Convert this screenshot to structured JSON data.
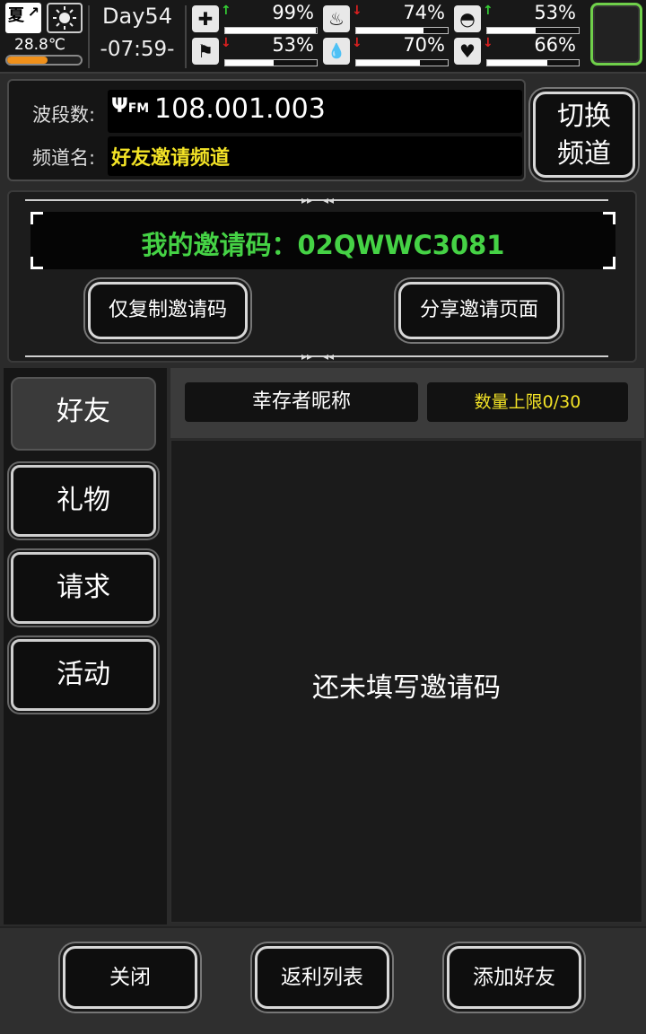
{
  "status": {
    "season": "夏",
    "temperature": "28.8℃",
    "temperature_level": 0.55,
    "day": "Day54",
    "time": "-07:59-",
    "stats": [
      {
        "name": "health",
        "icon": "✚",
        "arrow": "↑",
        "arrow_color": "#35d035",
        "value": "99%",
        "fraction": 0.99
      },
      {
        "name": "stomach",
        "icon": "♨",
        "arrow": "↓",
        "arrow_color": "#e02020",
        "value": "74%",
        "fraction": 0.74
      },
      {
        "name": "medicine",
        "icon": "◓",
        "arrow": "↑",
        "arrow_color": "#35d035",
        "value": "53%",
        "fraction": 0.53
      },
      {
        "name": "stamina",
        "icon": "⚑",
        "arrow": "↓",
        "arrow_color": "#e02020",
        "value": "53%",
        "fraction": 0.53
      },
      {
        "name": "water",
        "icon": "💧",
        "arrow": "↓",
        "arrow_color": "#e02020",
        "value": "70%",
        "fraction": 0.7
      },
      {
        "name": "mood",
        "icon": "♥",
        "arrow": "↓",
        "arrow_color": "#e02020",
        "value": "66%",
        "fraction": 0.66
      }
    ]
  },
  "channel": {
    "band_label": "波段数:",
    "band_value": "108.001.003",
    "name_label": "频道名:",
    "name_value": "好友邀请频道",
    "switch_label_1": "切换",
    "switch_label_2": "频道"
  },
  "invite": {
    "code_text": "我的邀请码：02QWWC3081",
    "copy_button": "仅复制邀请码",
    "share_button": "分享邀请页面"
  },
  "nav": {
    "tabs": [
      "好友",
      "礼物",
      "请求",
      "活动"
    ]
  },
  "list": {
    "col_name": "幸存者昵称",
    "col_limit": "数量上限0/30",
    "empty_text": "还未填写邀请码"
  },
  "footer": {
    "close": "关闭",
    "rebate": "返利列表",
    "add_friend": "添加好友"
  },
  "colors": {
    "code_green": "#45d245",
    "channel_yellow": "#f3e326",
    "limit_yellow": "#f3e326",
    "corner_green": "#6fcf4a"
  }
}
